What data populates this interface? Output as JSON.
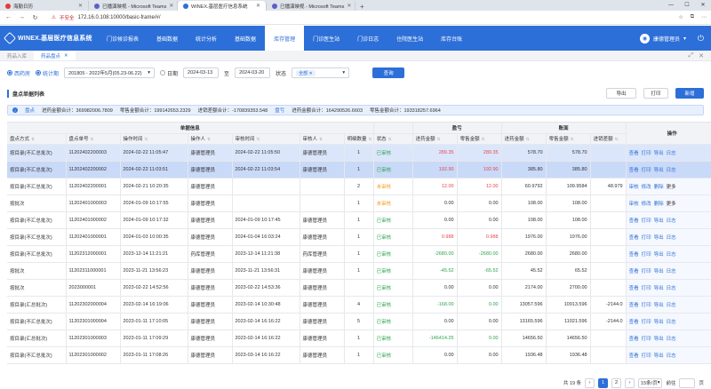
{
  "browser": {
    "tabs": [
      {
        "label": "海勤日历",
        "color": "#e53935"
      },
      {
        "label": "已播演映视 - Microsoft Teams",
        "color": "#5b5fc7"
      },
      {
        "label": "WINEX.基层医疗信息系统",
        "color": "#2d6fd8"
      },
      {
        "label": "已播演映视 - Microsoft Teams",
        "color": "#5b5fc7"
      }
    ],
    "security": "不安全",
    "url": "172.16.0.108:10000/basic-frame/#/"
  },
  "nav": {
    "logo": "WINEX.基层医疗信息系统",
    "items": [
      "门诊候诊报表",
      "基础数据",
      "统计分析",
      "基础数据",
      "库存管理",
      "门诊医生站",
      "门诊日志",
      "住院医生站",
      "库存台账"
    ],
    "active_index": 4,
    "user": "康德管理员"
  },
  "page_tabs": [
    "药品入库",
    "药品盘点"
  ],
  "filter": {
    "radio1": "西药房",
    "radio2": "统计期",
    "period": "201805 - 2022年5月(05.23-06.22)",
    "radio3": "日期",
    "date_from": "2024-03-13",
    "to_label": "至",
    "date_to": "2024-03-20",
    "status_label": "状态",
    "status_chip": "全部",
    "query": "查询"
  },
  "section": {
    "title": "盘点单据列表",
    "export": "导出",
    "print": "打印",
    "add": "新增"
  },
  "summary": {
    "tag1": "盘点",
    "purchase": "进药金额合计：369982006.7809",
    "retail": "零售金额合计：199142653.2329",
    "purchase_diff": "进销差额合计：-170839353.548",
    "tag2": "盘亏",
    "purchase2": "进药金额合计：164290526.6603",
    "retail2": "零售金额合计：193318257.6964"
  },
  "table": {
    "group_headers": [
      "单据信息",
      "盈亏",
      "账面",
      "操作"
    ],
    "headers": [
      "盘点方式",
      "盘点单号",
      "操作时间",
      "操作人",
      "审核时间",
      "审核人",
      "明细数量",
      "状态",
      "进药金额",
      "零售金额",
      "进药金额",
      "零售金额",
      "进销差额"
    ],
    "rows": [
      {
        "mode": "按目录(不汇总批次)",
        "no": "11202402200003",
        "optime": "2024-02-22 11:05:47",
        "op": "康德管理员",
        "audtime": "2024-02-22 11:05:50",
        "aud": "康德管理员",
        "qty": "1",
        "status": "已审核",
        "pl_p": "289.35",
        "pl_r": "289.35",
        "bk_p": "578.70",
        "bk_r": "578.70",
        "diff": "",
        "ops": [
          "查看",
          "打印",
          "导出",
          "日志"
        ],
        "hl": "hl",
        "sign": "neg"
      },
      {
        "mode": "按目录(不汇总批次)",
        "no": "11202402200002",
        "optime": "2024-02-22 11:03:51",
        "op": "康德管理员",
        "audtime": "2024-02-22 11:03:54",
        "aud": "康德管理员",
        "qty": "1",
        "status": "已审核",
        "pl_p": "192.90",
        "pl_r": "192.90",
        "bk_p": "385.80",
        "bk_r": "385.80",
        "diff": "",
        "ops": [
          "查看",
          "打印",
          "导出",
          "日志"
        ],
        "hl": "hl2",
        "sign": "neg"
      },
      {
        "mode": "按目录(不汇总批次)",
        "no": "11202402200001",
        "optime": "2024-02-21 10:20:35",
        "op": "康德管理员",
        "audtime": "",
        "aud": "",
        "qty": "2",
        "status": "未审核",
        "pl_p": "12.00",
        "pl_r": "12.00",
        "bk_p": "60.9792",
        "bk_r": "109.9584",
        "diff": "48.979",
        "ops": [
          "审核",
          "修改",
          "删除",
          "更多"
        ],
        "hl": "",
        "sign": "neg"
      },
      {
        "mode": "按批次",
        "no": "11202401000003",
        "optime": "2024-01-09 10:17:55",
        "op": "康德管理员",
        "audtime": "",
        "aud": "",
        "qty": "1",
        "status": "未审核",
        "pl_p": "0.00",
        "pl_r": "0.00",
        "bk_p": "108.00",
        "bk_r": "108.00",
        "diff": "",
        "ops": [
          "审核",
          "修改",
          "删除",
          "更多"
        ],
        "hl": "",
        "sign": ""
      },
      {
        "mode": "按目录(不汇总批次)",
        "no": "11202401000002",
        "optime": "2024-01-09 10:17:32",
        "op": "康德管理员",
        "audtime": "2024-01-09 10:17:45",
        "aud": "康德管理员",
        "qty": "1",
        "status": "已审核",
        "pl_p": "0.00",
        "pl_r": "0.00",
        "bk_p": "108.00",
        "bk_r": "108.00",
        "diff": "",
        "ops": [
          "查看",
          "打印",
          "导出",
          "日志"
        ],
        "hl": "",
        "sign": ""
      },
      {
        "mode": "按目录(不汇总批次)",
        "no": "11202401000001",
        "optime": "2024-01-03 10:00:35",
        "op": "康德管理员",
        "audtime": "2024-01-04 16:03:24",
        "aud": "康德管理员",
        "qty": "1",
        "status": "已审核",
        "pl_p": "0.988",
        "pl_r": "0.988",
        "bk_p": "1976.00",
        "bk_r": "1976.00",
        "diff": "",
        "ops": [
          "查看",
          "打印",
          "导出",
          "日志"
        ],
        "hl": "",
        "sign": "neg"
      },
      {
        "mode": "按目录(不汇总批次)",
        "no": "11202312000001",
        "optime": "2023-12-14 11:21:21",
        "op": "药库管理员",
        "audtime": "2023-12-14 11:21:38",
        "aud": "药库管理员",
        "qty": "1",
        "status": "已审核",
        "pl_p": "-2680.00",
        "pl_r": "-2680.00",
        "bk_p": "2680.00",
        "bk_r": "2680.00",
        "diff": "",
        "ops": [
          "查看",
          "打印",
          "导出",
          "日志"
        ],
        "hl": "",
        "sign": "pos"
      },
      {
        "mode": "按批次",
        "no": "11202311000001",
        "optime": "2023-11-21 13:56:23",
        "op": "康德管理员",
        "audtime": "2023-11-21 13:56:31",
        "aud": "康德管理员",
        "qty": "1",
        "status": "已审核",
        "pl_p": "-45.52",
        "pl_r": "-65.52",
        "bk_p": "45.52",
        "bk_r": "65.52",
        "diff": "",
        "ops": [
          "查看",
          "打印",
          "导出",
          "日志"
        ],
        "hl": "",
        "sign": "pos"
      },
      {
        "mode": "按批次",
        "no": "2023000001",
        "optime": "2023-02-22 14:52:56",
        "op": "康德管理员",
        "audtime": "2023-02-22 14:53:36",
        "aud": "康德管理员",
        "qty": "",
        "status": "已审核",
        "pl_p": "0.00",
        "pl_r": "0.00",
        "bk_p": "2174.00",
        "bk_r": "2700.00",
        "diff": "",
        "ops": [
          "查看",
          "打印",
          "导出",
          "日志"
        ],
        "hl": "",
        "sign": ""
      },
      {
        "mode": "按目录(汇总批次)",
        "no": "11202302000004",
        "optime": "2023-02-14 16:19:06",
        "op": "康德管理员",
        "audtime": "2023-02-14 10:30:48",
        "aud": "康德管理员",
        "qty": "4",
        "status": "已审核",
        "pl_p": "-168.00",
        "pl_r": "0.00",
        "bk_p": "13057.596",
        "bk_r": "10913.596",
        "diff": "-2144.0",
        "ops": [
          "查看",
          "打印",
          "导出",
          "日志"
        ],
        "hl": "",
        "sign": "pos"
      },
      {
        "mode": "按目录(不汇总批次)",
        "no": "11202301000004",
        "optime": "2023-01-11 17:10:05",
        "op": "康德管理员",
        "audtime": "2023-02-14 16:16:22",
        "aud": "康德管理员",
        "qty": "5",
        "status": "已审核",
        "pl_p": "0.00",
        "pl_r": "0.00",
        "bk_p": "13165.596",
        "bk_r": "11021.596",
        "diff": "-2144.0",
        "ops": [
          "查看",
          "打印",
          "导出",
          "日志"
        ],
        "hl": "",
        "sign": ""
      },
      {
        "mode": "按目录(汇总批次)",
        "no": "11202301000003",
        "optime": "2023-01-11 17:09:29",
        "op": "康德管理员",
        "audtime": "2023-02-14 16:16:22",
        "aud": "康德管理员",
        "qty": "1",
        "status": "已审核",
        "pl_p": "-146414.25",
        "pl_r": "0.00",
        "bk_p": "14656.50",
        "bk_r": "14656.50",
        "diff": "",
        "ops": [
          "查看",
          "打印",
          "导出",
          "日志"
        ],
        "hl": "",
        "sign": "pos"
      },
      {
        "mode": "按目录(不汇总批次)",
        "no": "11202301000002",
        "optime": "2023-01-11 17:08:26",
        "op": "康德管理员",
        "audtime": "2023-03-14 16:16:22",
        "aud": "康德管理员",
        "qty": "1",
        "status": "已审核",
        "pl_p": "0.00",
        "pl_r": "0.00",
        "bk_p": "1936.48",
        "bk_r": "1936.48",
        "diff": "",
        "ops": [
          "查看",
          "打印",
          "导出",
          "日志"
        ],
        "hl": "",
        "sign": ""
      }
    ]
  },
  "pager": {
    "total": "共 19 条",
    "pages": [
      "1",
      "2"
    ],
    "size": "15条/页",
    "goto": "前往",
    "page_suffix": "页"
  }
}
